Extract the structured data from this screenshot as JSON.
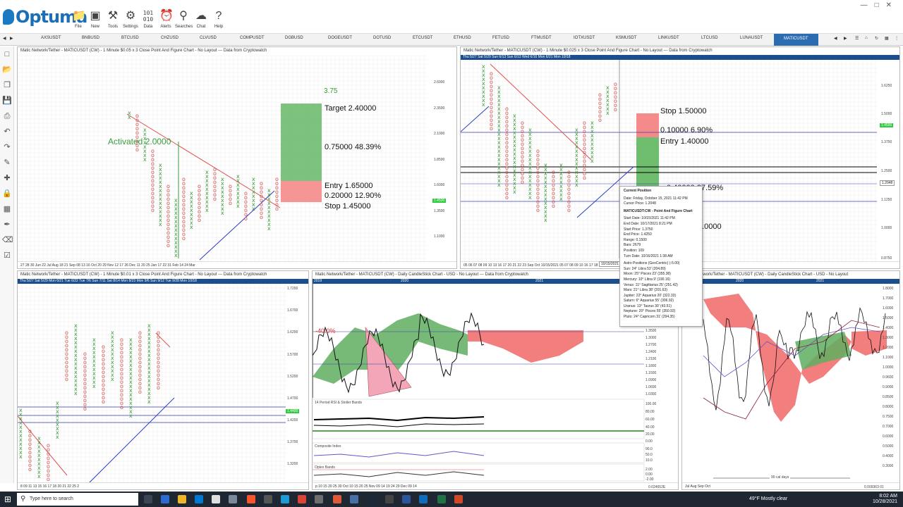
{
  "app": {
    "logo_text": "Optuma",
    "brand_color": "#1a6fb8"
  },
  "toolbar": [
    {
      "label": "File",
      "icon": "folder-icon"
    },
    {
      "label": "New",
      "icon": "new-window-icon"
    },
    {
      "label": "Tools",
      "icon": "tools-icon"
    },
    {
      "label": "Settings",
      "icon": "gear-icon"
    },
    {
      "label": "Data",
      "icon": "data-icon"
    },
    {
      "label": "Alerts",
      "icon": "alarm-clock-icon"
    },
    {
      "label": "Searches",
      "icon": "magnifier-icon"
    },
    {
      "label": "Chat",
      "icon": "chat-icon"
    },
    {
      "label": "Help",
      "icon": "question-icon"
    }
  ],
  "tabs": [
    "AXSUSDT",
    "BNBUSD",
    "BTCUSD",
    "CHZUSD",
    "CLVUSD",
    "COMPUSDT",
    "DGBUSD",
    "DOGEUSDT",
    "DOTUSD",
    "ETCUSDT",
    "ETHUSD",
    "FETUSD",
    "FTMUSDT",
    "IOTXUSDT",
    "KSMUSDT",
    "LINKUSDT",
    "LTCUSD",
    "LUNAUSDT",
    "MATICUSDT"
  ],
  "active_tab": "MATICUSDT",
  "panes": {
    "p1": {
      "title": "Matic Network/Tether - MATICUSDT (CW) - 1 Minute $0.05 x 3 Close Point And Figure Chart - No Layout --- Data from Cryptowatch",
      "labels": {
        "top": "3.75",
        "target": "Target  2.40000",
        "mid": "0.75000   48.39%",
        "entry": "Entry  1.65000",
        "risk": "0.20000   12.90%",
        "stop": "Stop  1.45000",
        "activated": "Activated 2.0000"
      },
      "price_badge": "1.4500",
      "y_ticks": [
        "2.6000",
        "2.3500",
        "2.1000",
        "1.8500",
        "1.6000",
        "1.3500",
        "1.1000"
      ],
      "x_axis": "27   28   30  Jun   22   Jul        Aug   18 21        Sep   08    13 16     Oct      20     29 Nov 12 17   26 Dec 11     20 25     Jan       17 22     31 Feb 14    24  Mar"
    },
    "p2": {
      "title": "Matic Network/Tether - MATICUSDT (CW) - 1 Minute $0.025 x 3 Close Point And Figure Chart - No Layout --- Data from Cryptowatch",
      "date_strip": "Thu 5/27    Sat 5/29   Sun 6/13   Sun 6/13    Wed 6/16   Mon 6/21   Mon 10/18",
      "labels": {
        "stop": "Stop  1.50000",
        "risk": "0.10000   6.90%",
        "entry": "Entry  1.40000",
        "mid": "0.40000   27.59%",
        "target": "0.0000"
      },
      "price_badge": "1.4500",
      "cursor_badge": "1.2048",
      "y_ticks": [
        "1.6250",
        "1.5000",
        "1.3750",
        "1.2500",
        "1.1250",
        "1.0000",
        "0.8750"
      ],
      "x_axis": "05   06   07    08   09   10 13 16   17    20   21 22 23    Sep     Oct   10/15/2021          05  07  08 09 10   16 17 18   21 23 25 27   Dec   04 06 08 10   13",
      "date_badge": "10/15/2021"
    },
    "p3": {
      "title": "Matic Network/Tether - MATICUSDT (CW) - 1 Minute $0.01 x 3 Close Point And Figure Chart - No Layout --- Data from Cryptowatch",
      "date_strip": "Thu 5/27       Sat 5/29      Mon 6/21    Tue 6/22    Tue 7/6   Sun 7/11   Sat 8/14    Mon 8/23    Mon 9/6   Sun 9/12   Tue 9/28   Mon 10/18",
      "price_badge": "1.4400",
      "y_ticks": [
        "1.7200",
        "1.6700",
        "1.6200",
        "1.5700",
        "1.5200",
        "1.4700",
        "1.4200",
        "1.3700",
        "1.3200"
      ],
      "x_axis": "8   09   11    13            15                     16         17      18         20         21               22               25         2"
    },
    "p4": {
      "title": "Matic Network/Tether - MATICUSDT (CW) - Daily CandleStick Chart - USD - No Layout --- Data from Cryptowatch",
      "years": [
        "2019",
        "2020",
        "2021"
      ],
      "pct_label": "-40.0%",
      "y_ticks": [
        "1.5100",
        "1.4900",
        "1.4700",
        "1.4500",
        "1.4300",
        "1.3900",
        "1.3500",
        "1.3000",
        "1.2700",
        "1.2400",
        "1.2100",
        "1.1800",
        "1.1500",
        "1.0900",
        "1.0600",
        "1.0300"
      ],
      "sub1": {
        "title": "14 Period RSI & Stoller Bands",
        "ticks": [
          "100.00",
          "80.00",
          "60.00",
          "40.00",
          "20.00",
          "0.00"
        ]
      },
      "sub2": {
        "title": "Composite Index",
        "ticks": [
          "90.0",
          "50.0",
          "10.0"
        ]
      },
      "sub3": {
        "title": "Optex Bands",
        "ticks": [
          "2.00",
          "0.00",
          "-2.00"
        ]
      },
      "x_axis": "p   10    15    20    25    30    Oct    10    15    20    25       Nov   09       14   19    24   29     Dec   09   14",
      "corner_value": "0.024652E"
    },
    "p5": {
      "title": "Matic Network/Tether - MATICUSDT (CW) - Daily CandleStick Chart - USD - No Layout",
      "years": [
        "2020",
        "2021"
      ],
      "y_ticks": [
        "1.8000",
        "1.7000",
        "1.6000",
        "1.5000",
        "1.4000",
        "1.3000",
        "1.2000",
        "1.1000",
        "1.0000",
        "0.9600",
        "0.9000",
        "0.8500",
        "0.8000",
        "0.7500",
        "0.7000",
        "0.6000",
        "0.5000",
        "0.4000",
        "0.3000"
      ],
      "cal_days": "90 cal days",
      "x_axis": "Jul                      Aug                         Sep                         Oct",
      "corner_value": "0.009363 01"
    }
  },
  "tooltip": {
    "title": "Current Position",
    "date": "Date: Friday, October 15, 2021 11:42 PM",
    "cursor": "Cursor Price: 1.2048",
    "chart": "MATICUSDT:CW - Point And Figure Chart",
    "rows": [
      "Start Date: 10/15/2021 11:42 PM",
      "End Date: 10/17/2021 8:21 PM",
      "Start Price: 1.3750",
      "End Price: 1.4250",
      "Range: 0.1500",
      "Bars: 2679",
      "Position: 109",
      "Turn Date: 10/16/2021 1:38 AM"
    ],
    "astro_title": "Astro Positions (GeoCentric) (-5.00)",
    "astro": [
      "Sun: 24° Libra 53' (204.89)",
      "Moon: 25° Pisces 23' (355.38)",
      "Mercury: 10° Libra 9' (190.16)",
      "Venus: 11° Sagittarius 25' (251.42)",
      "Mars: 21° Libra 38' (201.63)",
      "Jupiter: 22° Aquarius 20' (322.33)",
      "Saturn: 6° Aquarius 55' (306.92)",
      "Uranus: 13° Taurus 30' (43.51)",
      "Neptune: 20° Pisces 55' (350.92)",
      "Pluto: 24° Capricorn 31' (294.35)"
    ]
  },
  "taskbar": {
    "search_placeholder": "Type here to search",
    "weather": "49°F  Mostly clear",
    "time": "8:02 AM",
    "date": "10/28/2021"
  }
}
